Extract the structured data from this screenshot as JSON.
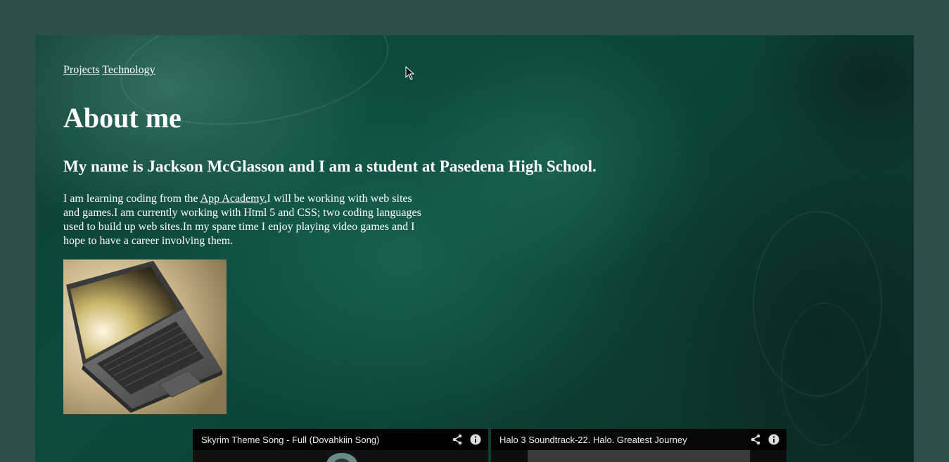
{
  "nav": {
    "projects": "Projects",
    "technology": "Technology"
  },
  "page_title": "About me",
  "subtitle": "My name is Jackson McGlasson and I am a student at Pasedena High School.",
  "about": {
    "text_before_link": "I am learning coding from the ",
    "link_text": "App Academy.",
    "text_after_link": "I will be working with web sites and games.I am currently working with Html 5 and CSS; two coding languages used to build up web sites.In my spare time I enjoy playing video games and I hope to have a career involving them."
  },
  "videos": [
    {
      "title": "Skyrim Theme Song - Full (Dovahkiin Song)",
      "share_icon": "share-icon",
      "info_icon": "info-icon"
    },
    {
      "title": "Halo 3 Soundtrack-22. Halo. Greatest Journey",
      "share_icon": "share-icon",
      "info_icon": "info-icon"
    }
  ],
  "colors": {
    "outer_background": "#2f4f4f",
    "panel_green": "#0d4a3f",
    "text": "#ffffff",
    "video_bar": "#0a0a0a"
  }
}
